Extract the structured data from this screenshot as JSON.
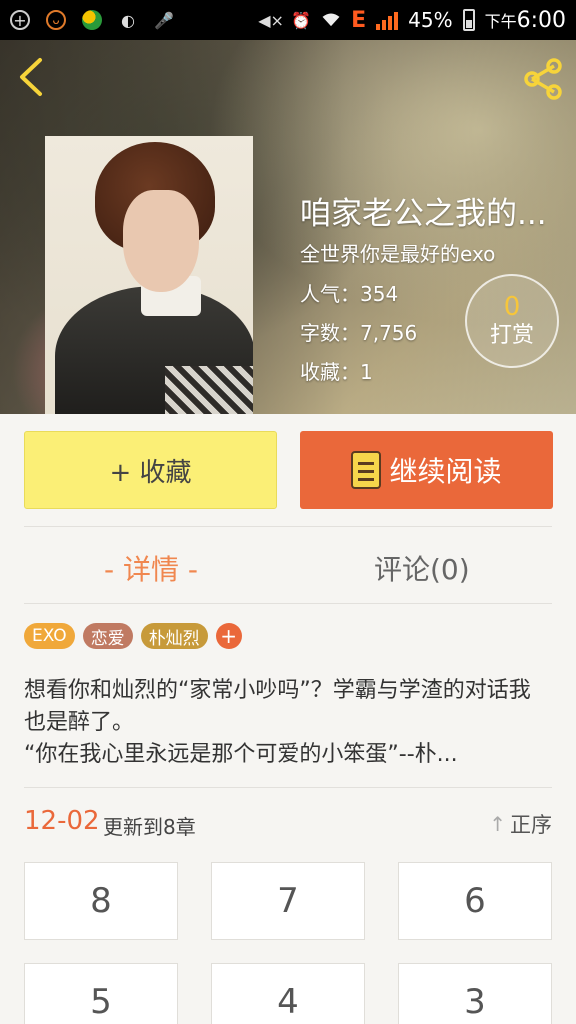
{
  "status_bar": {
    "battery": "45%",
    "network": "E",
    "ampm": "下午",
    "time": "6:00"
  },
  "book": {
    "title": "咱家老公之我的...",
    "author": "全世界你是最好的exo",
    "popularity": "人气：354",
    "word_count": "字数：7,756",
    "favorites": "收藏：1"
  },
  "tip": {
    "count": "0",
    "label": "打赏"
  },
  "actions": {
    "favorite": "+ 收藏",
    "continue_reading": "继续阅读"
  },
  "tabs": {
    "detail": "- 详情 -",
    "comments": "评论(0)"
  },
  "tags": [
    "EXO",
    "恋爱",
    "朴灿烈"
  ],
  "tag_add": "+",
  "description": {
    "line1": "想看你和灿烈的“家常小吵吗”？学霸与学渣的对话我也是醉了。",
    "line2": "“你在我心里永远是那个可爱的小笨蛋”--朴..."
  },
  "updates": {
    "date": "12-02",
    "text": "更新到8章",
    "sort": "正序"
  },
  "chapters": [
    "8",
    "7",
    "6",
    "5",
    "4",
    "3"
  ],
  "colors": {
    "accent": "#ea683a",
    "favorite_bg": "#fbef76",
    "tip_count": "#f7c63a"
  }
}
